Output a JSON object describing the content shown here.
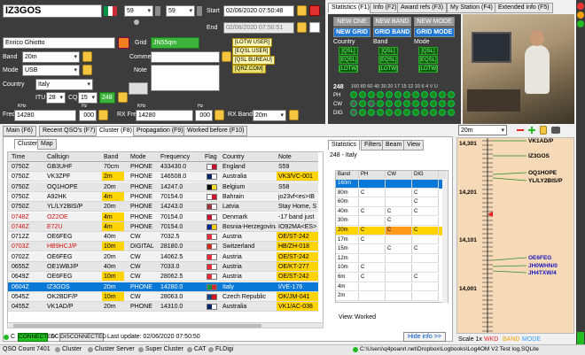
{
  "entry": {
    "callsign": "IZ3GOS",
    "rst_s": "59",
    "rst_r": "59",
    "start_label": "Start",
    "start_value": "02/06/2020 07:50:48",
    "end_label": "End",
    "end_value": "02/06/2020 07:50:51",
    "name": "Enrico Ghiotto",
    "grid_label": "Grid",
    "grid_value": "JN55qm",
    "band_label": "Band",
    "band_value": "20m",
    "comment_label": "Comment",
    "mode_label": "Mode",
    "mode_value": "USB",
    "note_label": "Note",
    "country_label": "Country",
    "country_value": "Italy",
    "itu_label": "ITU",
    "itu_value": "28",
    "cq_label": "CQ",
    "cq_value": "15",
    "dxcc_value": "248",
    "freq_label": "Freq",
    "khz": "KHz",
    "hz": "Hz",
    "freq_value": "14280",
    "freq_hz": "000",
    "rx_freq_label": "RX Freq",
    "rx_freq_value": "14280",
    "rx_hz": "000",
    "rx_band_label": "RX Band",
    "rx_band_value": "20m"
  },
  "qsl_tags": [
    "[LOTW USER]",
    "[EQSL USER]",
    "[QSL BUREAU]",
    "[QRZ.COM]"
  ],
  "info_tabs": [
    "Statistics (F1)",
    "Info (F2)",
    "Award refs (F3)",
    "My Station (F4)",
    "Extended info (F5)"
  ],
  "info": {
    "new_one": "NEW ONE",
    "new_band": "NEW BAND",
    "new_mode": "NEW MODE",
    "new_grid": "NEW GRID",
    "grid_band": "GRID BAND",
    "grid_mode": "GRID MODE",
    "col_country": "Country",
    "col_band": "Band",
    "col_mode": "Mode",
    "qsl": "[QSL]",
    "eqsl": "[EQSL]",
    "lotw": "[LOTW]",
    "dxcc": "248",
    "bands_header": "160 80 60 40 30 20 17 15 12 10 6 4 V U",
    "ph": "PH",
    "cw": "CW",
    "dig": "DIG"
  },
  "main_tabs": [
    "Main (F6)",
    "Recent QSO's (F7)",
    "Cluster (F8)",
    "Propagation (F9)",
    "Worked before (F10)"
  ],
  "sub_tabs": [
    "Cluster",
    "Map"
  ],
  "cluster_headers": [
    "Time",
    "Callsign",
    "Band",
    "Mode",
    "Frequency",
    "Flag",
    "Country",
    "Note"
  ],
  "cluster_rows": [
    {
      "time": "0750Z",
      "call": "GB3UHF",
      "band": "70cm",
      "mode": "PHONE",
      "freq": "433430.0",
      "country": "England",
      "note": "S59"
    },
    {
      "time": "0750Z",
      "call": "VK3ZPF",
      "band": "2m",
      "mode": "PHONE",
      "freq": "146508.0",
      "country": "Australia",
      "note": "VK3/VC-001"
    },
    {
      "time": "0750Z",
      "call": "OQ1HOPE",
      "band": "20m",
      "mode": "PHONE",
      "freq": "14247.0",
      "country": "Belgium",
      "note": "S58"
    },
    {
      "time": "0750Z",
      "call": "A92HK",
      "band": "4m",
      "mode": "PHONE",
      "freq": "70154.0",
      "country": "Bahrain",
      "note": "jo23vf<es>IB"
    },
    {
      "time": "0750Z",
      "call": "YL/LY2BIS/P",
      "band": "20m",
      "mode": "PHONE",
      "freq": "14243.0",
      "country": "Latvia",
      "note": "Stay Home, S"
    },
    {
      "time": "0748Z",
      "call": "OZ2OE",
      "band": "4m",
      "mode": "PHONE",
      "freq": "70154.0",
      "country": "Denmark",
      "note": "-17 band just"
    },
    {
      "time": "0746Z",
      "call": "E72U",
      "band": "4m",
      "mode": "PHONE",
      "freq": "70154.0",
      "country": "Bosnia-Herzegovina",
      "note": "IO92MA<ES>"
    },
    {
      "time": "0712Z",
      "call": "OE6FEG",
      "band": "40m",
      "mode": "CW",
      "freq": "7032.5",
      "country": "Austria",
      "note": "OE/ST-242"
    },
    {
      "time": "0703Z",
      "call": "HB9HCJ/P",
      "band": "10m",
      "mode": "DIGITAL",
      "freq": "28180.0",
      "country": "Switzerland",
      "note": "HB/ZH-018"
    },
    {
      "time": "0702Z",
      "call": "OE6FEG",
      "band": "20m",
      "mode": "CW",
      "freq": "14062.5",
      "country": "Austria",
      "note": "OE/ST-242"
    },
    {
      "time": "0655Z",
      "call": "OE1WBJ/P",
      "band": "40m",
      "mode": "CW",
      "freq": "7033.0",
      "country": "Austria",
      "note": "OE/KT-277"
    },
    {
      "time": "0649Z",
      "call": "OE6FEG",
      "band": "10m",
      "mode": "CW",
      "freq": "28062.5",
      "country": "Austria",
      "note": "OE/ST-242"
    },
    {
      "time": "0604Z",
      "call": "IZ3GOS",
      "band": "20m",
      "mode": "PHONE",
      "freq": "14280.0",
      "country": "Italy",
      "note": "I/VE-176"
    },
    {
      "time": "0545Z",
      "call": "OK2BDF/P",
      "band": "10m",
      "mode": "CW",
      "freq": "28063.0",
      "country": "Czech Republic",
      "note": "OK/JM-041"
    },
    {
      "time": "0455Z",
      "call": "VK1AD/P",
      "band": "20m",
      "mode": "PHONE",
      "freq": "14310.0",
      "country": "Australia",
      "note": "VK1/AC-038"
    }
  ],
  "band_tabs": [
    "Statistics",
    "Filters",
    "Beam",
    "View"
  ],
  "band_title": "248 - Italy",
  "band_headers": [
    "Band",
    "PH",
    "CW",
    "DIG"
  ],
  "band_rows": [
    {
      "band": "160m",
      "ph": "",
      "cw": "",
      "dig": ""
    },
    {
      "band": "80m",
      "ph": "C",
      "cw": "",
      "dig": "C"
    },
    {
      "band": "60m",
      "ph": "",
      "cw": "",
      "dig": "C"
    },
    {
      "band": "40m",
      "ph": "C",
      "cw": "C",
      "dig": "C"
    },
    {
      "band": "30m",
      "ph": "",
      "cw": "C",
      "dig": ""
    },
    {
      "band": "20m",
      "ph": "C",
      "cw": "C",
      "dig": "C"
    },
    {
      "band": "17m",
      "ph": "C",
      "cw": "",
      "dig": ""
    },
    {
      "band": "15m",
      "ph": "",
      "cw": "C",
      "dig": "C"
    },
    {
      "band": "12m",
      "ph": "",
      "cw": "",
      "dig": ""
    },
    {
      "band": "10m",
      "ph": "C",
      "cw": "",
      "dig": ""
    },
    {
      "band": "6m",
      "ph": "C",
      "cw": "",
      "dig": "C"
    },
    {
      "band": "4m",
      "ph": "",
      "cw": "",
      "dig": ""
    },
    {
      "band": "2m",
      "ph": "",
      "cw": "",
      "dig": ""
    }
  ],
  "band_footer": {
    "view": "View:",
    "worked": "Worked"
  },
  "bandmap": {
    "band": "20m",
    "freqs": [
      "14,301",
      "14,201",
      "14,101",
      "14,001"
    ],
    "spots": [
      "VK1AD/P",
      "IZ3GOS",
      "OQ1HOPE",
      "YL/LY2BIS/P",
      "OE6FEG",
      "JH0WHN/0",
      "JH4TXW/4"
    ],
    "scale": "Scale 1x",
    "wkd": "WKD",
    "band_lbl": "BAND",
    "mode_lbl": "MODE"
  },
  "status": {
    "c1": "C",
    "connected": "CONNECTED",
    "sc": "SC",
    "disconnected": "DISCONNECTED",
    "last_update": "Last update: 02/06/2020 07:50:50",
    "hide_info": "Hide info >>"
  },
  "bottom": {
    "qso_count": "QSO Count 7401",
    "cluster": "Cluster",
    "cluster_server": "Cluster Server",
    "super_cluster": "Super Cluster",
    "cat": "CAT",
    "fldigi": "FLDigi",
    "path": "C:\\Users\\q4poanrl.net\\Dropbox\\Logbooks\\Log4OM V2 Test log.SQLite"
  },
  "colors": {
    "header_bg": "#3c3c3c",
    "selected_row": "#0a78d7",
    "yellow": "#ffd400",
    "orange": "#ff9a1a",
    "green_status": "#22c322"
  }
}
